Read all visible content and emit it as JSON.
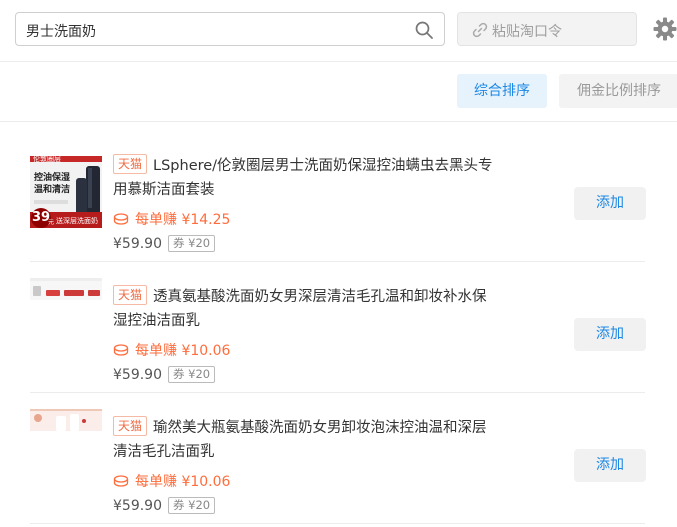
{
  "search": {
    "value": "男士洗面奶"
  },
  "paste": {
    "label": "粘贴淘口令"
  },
  "sort": {
    "tabs": [
      "综合排序",
      "佣金比例排序"
    ]
  },
  "colors": {
    "accent": "#1e88e5",
    "earn": "#ff6d3d",
    "tmall": "#f06d45"
  },
  "products": [
    {
      "badge": "天猫",
      "title": "LSphere/伦敦圈层男士洗面奶保湿控油螨虫去黑头专用慕斯洁面套装",
      "earn": "每单赚 ¥14.25",
      "price": "¥59.90",
      "coupon": "券 ¥20",
      "add": "添加",
      "thumb": {
        "brand": "伦敦圈层",
        "line1": "控油保湿",
        "line2": "温和清洁",
        "price": "39",
        "price_unit": "元",
        "tag": "送深层洗面奶"
      }
    },
    {
      "badge": "天猫",
      "title": "透真氨基酸洗面奶女男深层清洁毛孔温和卸妆补水保湿控油洁面乳",
      "earn": "每单赚 ¥10.06",
      "price": "¥59.90",
      "coupon": "券 ¥20",
      "add": "添加"
    },
    {
      "badge": "天猫",
      "title": "瑜然美大瓶氨基酸洗面奶女男卸妆泡沫控油温和深层清洁毛孔洁面乳",
      "earn": "每单赚 ¥10.06",
      "price": "¥59.90",
      "coupon": "券 ¥20",
      "add": "添加"
    }
  ]
}
